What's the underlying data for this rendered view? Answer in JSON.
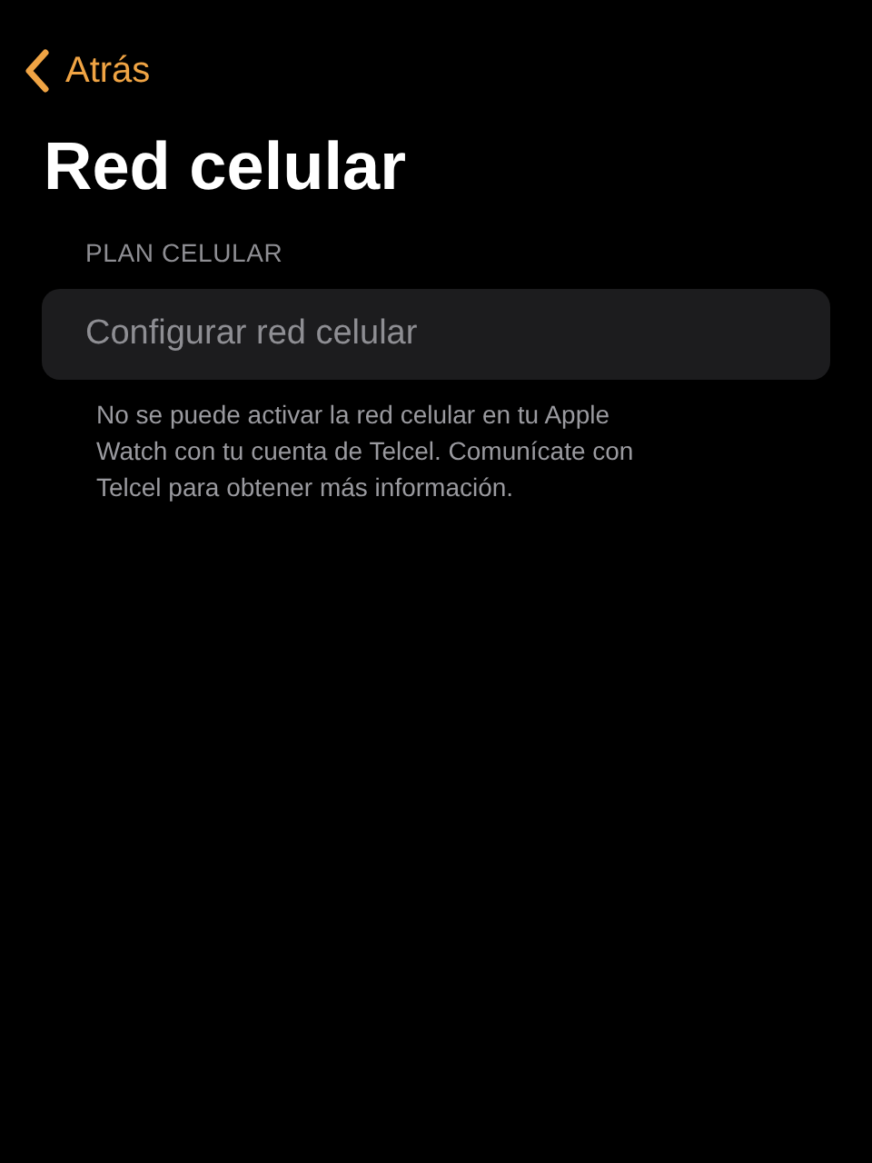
{
  "nav": {
    "back_label": "Atrás"
  },
  "title": "Red celular",
  "section": {
    "header": "PLAN CELULAR",
    "items": [
      {
        "label": "Configurar red celular",
        "disabled": true
      }
    ],
    "footer": "No se puede activar la red celular en tu Apple Watch con tu cuenta de Telcel. Comunícate con Telcel para obtener más información."
  }
}
